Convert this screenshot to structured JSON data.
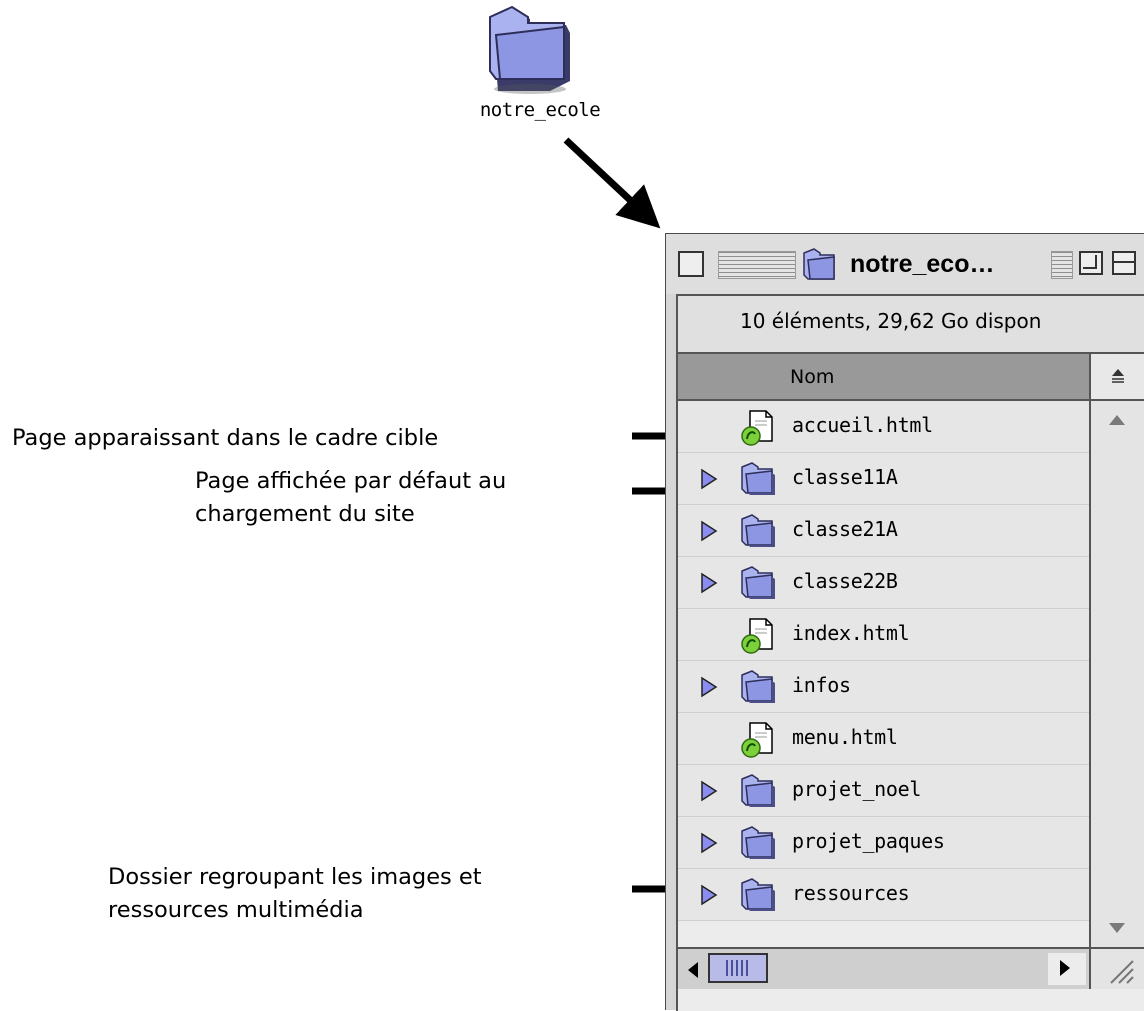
{
  "desktop": {
    "folder_label": "notre_ecole"
  },
  "window": {
    "title": "notre_eco…",
    "info": "10 éléments, 29,62 Go dispon",
    "column_name": "Nom"
  },
  "files": [
    {
      "name": "accueil.html",
      "kind": "html",
      "expandable": false
    },
    {
      "name": "classe11A",
      "kind": "folder",
      "expandable": true
    },
    {
      "name": "classe21A",
      "kind": "folder",
      "expandable": true
    },
    {
      "name": "classe22B",
      "kind": "folder",
      "expandable": true
    },
    {
      "name": "index.html",
      "kind": "html",
      "expandable": false
    },
    {
      "name": "infos",
      "kind": "folder",
      "expandable": true
    },
    {
      "name": "menu.html",
      "kind": "html",
      "expandable": false
    },
    {
      "name": "projet_noel",
      "kind": "folder",
      "expandable": true
    },
    {
      "name": "projet_paques",
      "kind": "folder",
      "expandable": true
    },
    {
      "name": "ressources",
      "kind": "folder",
      "expandable": true
    }
  ],
  "annotations": {
    "accueil": "Page apparaissant dans le cadre cible",
    "index_line1": "Page affichée par défaut au",
    "index_line2": "chargement du site",
    "ressources_line1": "Dossier regroupant les images et",
    "ressources_line2": "ressources multimédia"
  },
  "icons": {
    "folder": "folder-icon",
    "html": "dreamweaver-html-icon",
    "expand": "disclosure-triangle-icon",
    "arrow": "arrow-icon"
  },
  "colors": {
    "folder_fill": "#9da7ee",
    "html_badge": "#7cd13b",
    "triangle": "#8a8cf0"
  }
}
